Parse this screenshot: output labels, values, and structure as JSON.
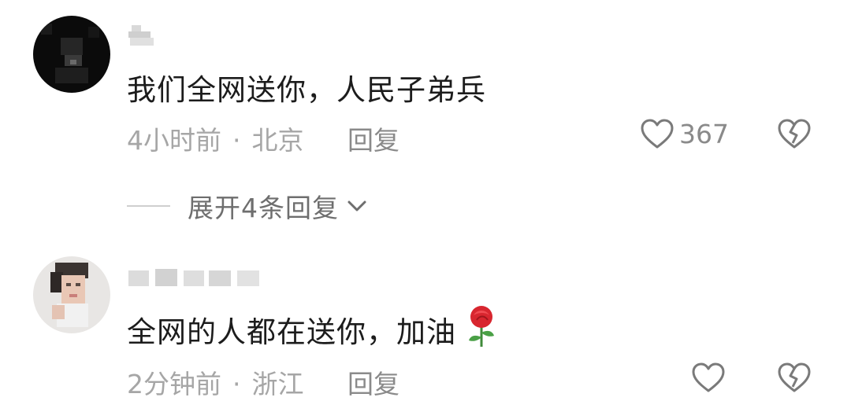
{
  "comments": [
    {
      "username": "",
      "text": "我们全网送你，人民子弟兵",
      "time": "4小时前",
      "separator": "·",
      "location": "北京",
      "reply_label": "回复",
      "likes": "367",
      "avatar_icon": "blurred-avatar-dark",
      "emoji": ""
    },
    {
      "username": "",
      "text": "全网的人都在送你，加油",
      "time": "2分钟前",
      "separator": "·",
      "location": "浙江",
      "reply_label": "回复",
      "likes": "",
      "avatar_icon": "blurred-avatar-portrait",
      "emoji": "rose-icon"
    }
  ],
  "expand_replies": {
    "label": "展开4条回复"
  },
  "colors": {
    "text": "#1c1c1c",
    "meta": "#a6a6a6",
    "action": "#8a8a8a"
  }
}
